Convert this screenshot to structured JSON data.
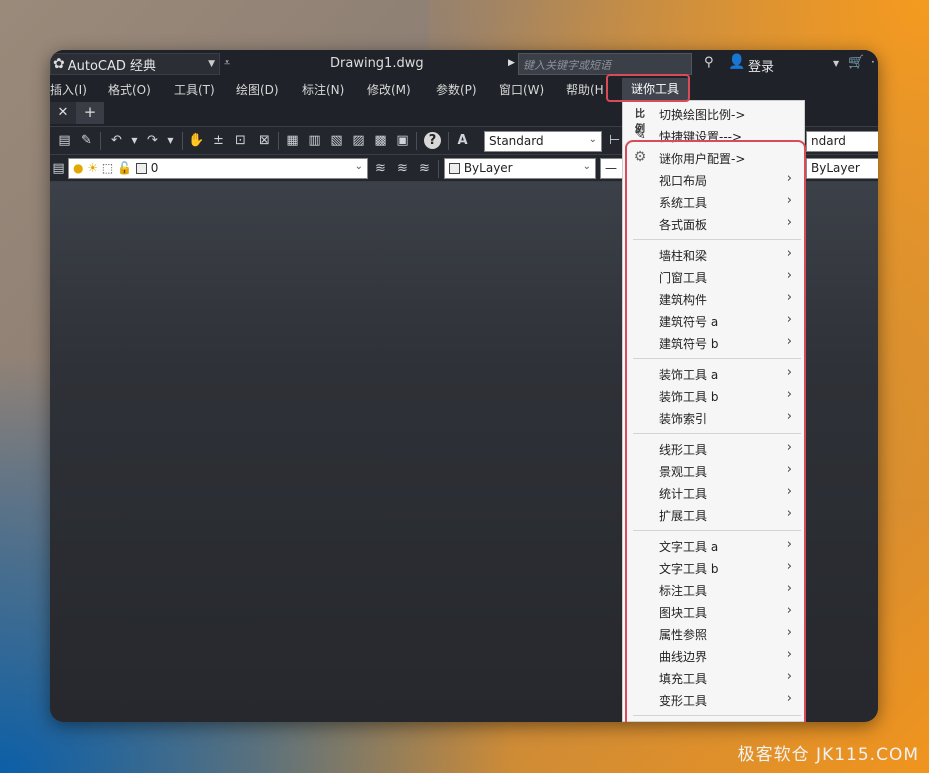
{
  "app": {
    "name": "AutoCAD 经典",
    "document_title": "Drawing1.dwg",
    "login_label": "登录"
  },
  "search": {
    "placeholder": "键入关键字或短语"
  },
  "menubar": {
    "items": [
      "插入(I)",
      "格式(O)",
      "工具(T)",
      "绘图(D)",
      "标注(N)",
      "修改(M)",
      "参数(P)",
      "窗口(W)",
      "帮助(H"
    ],
    "highlight": "谜你工具"
  },
  "tabs": {
    "close_glyph": "✕",
    "add_glyph": "+"
  },
  "toolbar1": {
    "text_style": "Standard",
    "dim_style": "ndard"
  },
  "toolbar2": {
    "layer_value": "0",
    "color_value": "ByLayer",
    "linetype_value": "ByLayer"
  },
  "dropdown": {
    "top_items": [
      {
        "label": "切换绘图比例->",
        "icon": "scale-icon"
      },
      {
        "label": "快捷键设置--->",
        "icon": "shortcut-edit-icon"
      },
      {
        "label": "谜你用户配置->",
        "icon": "gear-icon"
      }
    ],
    "groups": [
      [
        "视口布局",
        "系统工具",
        "各式面板"
      ],
      [
        "墙柱和梁",
        "门窗工具",
        "建筑构件",
        "建筑符号 a",
        "建筑符号 b"
      ],
      [
        "装饰工具 a",
        "装饰工具 b",
        "装饰索引"
      ],
      [
        "线形工具",
        "景观工具",
        "统计工具",
        "扩展工具"
      ],
      [
        "文字工具 a",
        "文字工具 b",
        "标注工具",
        "图块工具",
        "属性参照",
        "曲线边界",
        "填充工具",
        "变形工具"
      ]
    ]
  },
  "watermark": "极客软仓 JK115.COM",
  "colors": {
    "highlight": "#d94b58",
    "window_bg": "#2a2d33",
    "menu_bg": "#f6f6f6"
  }
}
